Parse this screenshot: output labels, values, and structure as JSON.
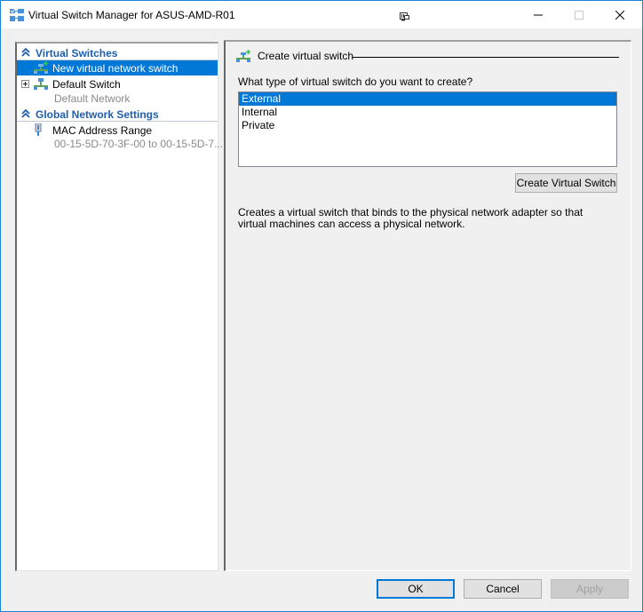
{
  "window": {
    "title": "Virtual Switch Manager for ASUS-AMD-R01",
    "app_icon": "virtual-switch-manager-icon",
    "controls": {
      "minimize": "minimize-icon",
      "maximize": "maximize-icon",
      "close": "close-icon"
    }
  },
  "tree": {
    "sections": [
      {
        "header": "Virtual Switches",
        "icon": "collapse-chevron-icon",
        "items": [
          {
            "label": "New virtual network switch",
            "icon": "new-switch-icon",
            "selected": true
          },
          {
            "label": "Default Switch",
            "sublabel": "Default Network",
            "icon": "network-switch-icon",
            "expandable": true
          }
        ]
      },
      {
        "header": "Global Network Settings",
        "icon": "collapse-chevron-icon",
        "items": [
          {
            "label": "MAC Address Range",
            "sublabel": "00-15-5D-70-3F-00 to 00-15-5D-7...",
            "icon": "mac-address-icon"
          }
        ]
      }
    ]
  },
  "detail": {
    "group_title": "Create virtual switch",
    "question": "What type of virtual switch do you want to create?",
    "switch_types": [
      "External",
      "Internal",
      "Private"
    ],
    "selected_type": "External",
    "create_button": "Create Virtual Switch",
    "description": "Creates a virtual switch that binds to the physical network adapter so that virtual machines can access a physical network."
  },
  "footer": {
    "ok": "OK",
    "cancel": "Cancel",
    "apply": "Apply"
  },
  "colors": {
    "selection": "#0078d7",
    "section_header": "#1e5fb0",
    "window_border": "#1883d7"
  }
}
